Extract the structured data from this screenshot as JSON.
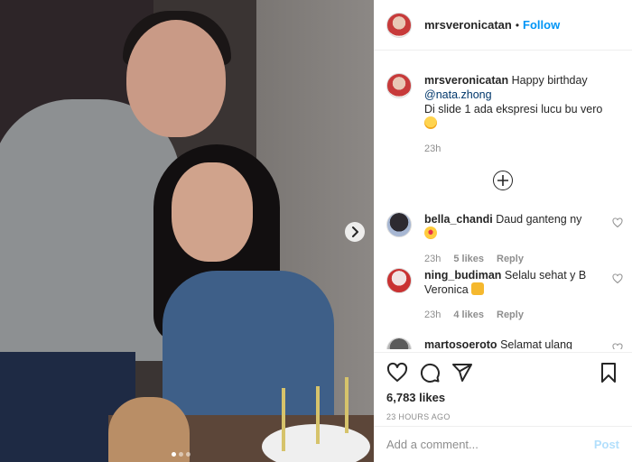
{
  "post": {
    "author": "mrsveronicatan",
    "separator": "•",
    "follow_label": "Follow"
  },
  "caption": {
    "username": "mrsveronicatan",
    "text_before": "Happy birthday",
    "mention": "@nata.zhong",
    "text_after": "Di slide 1 ada ekspresi lucu bu vero",
    "emoji": "grinning-face",
    "time": "23h"
  },
  "comments": [
    {
      "username": "bella_chandi",
      "text": "Daud ganteng ny",
      "emoji": "heart-eyes-face",
      "time": "23h",
      "likes": "5 likes",
      "reply": "Reply"
    },
    {
      "username": "ning_budiman",
      "text": "Selalu sehat y B Veronica",
      "emoji": "thumbs-up",
      "time": "23h",
      "likes": "4 likes",
      "reply": "Reply"
    },
    {
      "username": "martosoeroto",
      "text": "Selamat ulang"
    }
  ],
  "stats": {
    "likes": "6,783 likes",
    "timestamp": "23 HOURS AGO"
  },
  "comment_box": {
    "placeholder": "Add a comment...",
    "post_label": "Post"
  },
  "carousel": {
    "slide_count": 3,
    "active_slide": 1
  },
  "colors": {
    "link_blue": "#0095f6",
    "mention": "#00376b",
    "muted": "#8e8e8e",
    "post_disabled": "#b2dffc"
  }
}
